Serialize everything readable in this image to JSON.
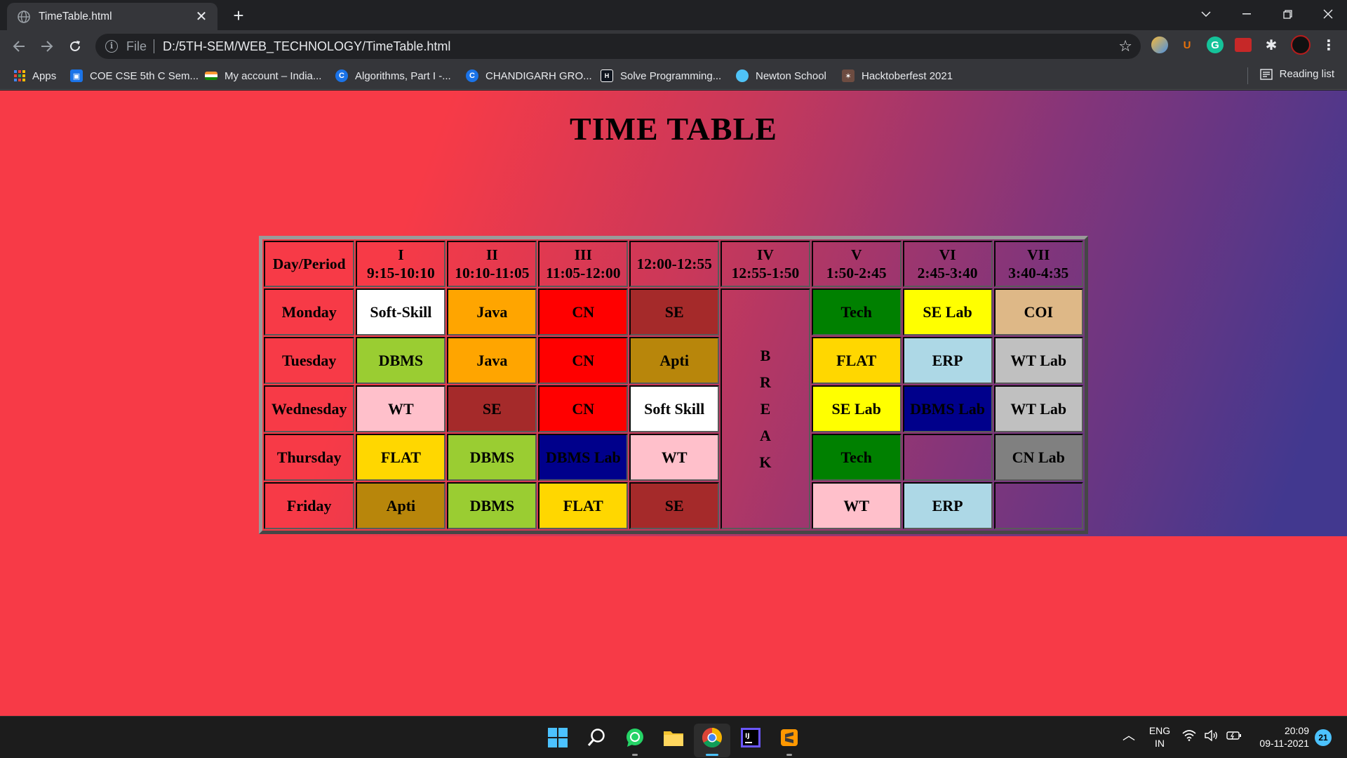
{
  "browser": {
    "tab_title": "TimeTable.html",
    "tab_close": "✕",
    "new_tab": "+",
    "file_chip": "File",
    "url": "D:/5TH-SEM/WEB_TECHNOLOGY/TimeTable.html",
    "extensions": [
      "chrome-ext-icon",
      "ublock-icon",
      "grammarly-icon",
      "ext-red-icon",
      "puzzle-icon",
      "profile-avatar"
    ]
  },
  "bookmarks": {
    "apps": "Apps",
    "items": [
      {
        "label": "COE CSE 5th C Sem...",
        "icon": "classroom-icon",
        "color": "#1a73e8"
      },
      {
        "label": "My account – India...",
        "icon": "india-flag-icon",
        "color": "#138808"
      },
      {
        "label": "Algorithms, Part I -...",
        "icon": "coursera-icon",
        "color": "#1a73e8"
      },
      {
        "label": "CHANDIGARH GRO...",
        "icon": "coursera-icon",
        "color": "#1a73e8"
      },
      {
        "label": "Solve Programming...",
        "icon": "hackerrank-icon",
        "color": "#0e141e"
      },
      {
        "label": "Newton School",
        "icon": "newton-icon",
        "color": "#4fc3f7"
      },
      {
        "label": "Hacktoberfest 2021",
        "icon": "hacktoberfest-icon",
        "color": "#ff8ae2"
      }
    ],
    "reading_list": "Reading list"
  },
  "page": {
    "title": "TIME TABLE",
    "table": {
      "header": [
        {
          "top": "",
          "bottom": "Day/Period"
        },
        {
          "top": "I",
          "bottom": "9:15-10:10"
        },
        {
          "top": "II",
          "bottom": "10:10-11:05"
        },
        {
          "top": "III",
          "bottom": "11:05-12:00"
        },
        {
          "top": "",
          "bottom": "12:00-12:55"
        },
        {
          "top": "IV",
          "bottom": "12:55-1:50"
        },
        {
          "top": "V",
          "bottom": "1:50-2:45"
        },
        {
          "top": "VI",
          "bottom": "2:45-3:40"
        },
        {
          "top": "VII",
          "bottom": "3:40-4:35"
        }
      ],
      "break_letters": [
        "B",
        "R",
        "E",
        "A",
        "K"
      ],
      "rows": [
        {
          "day": "Monday",
          "cells": [
            {
              "text": "Soft-Skill",
              "bg": "#ffffff"
            },
            {
              "text": "Java",
              "bg": "#ffa500"
            },
            {
              "text": "CN",
              "bg": "#ff0000"
            },
            {
              "text": "SE",
              "bg": "#a52a2a"
            },
            {
              "text": "Tech",
              "bg": "#008000"
            },
            {
              "text": "SE Lab",
              "bg": "#ffff00"
            },
            {
              "text": "COI",
              "bg": "#deb887"
            }
          ]
        },
        {
          "day": "Tuesday",
          "cells": [
            {
              "text": "DBMS",
              "bg": "#9acd32"
            },
            {
              "text": "Java",
              "bg": "#ffa500"
            },
            {
              "text": "CN",
              "bg": "#ff0000"
            },
            {
              "text": "Apti",
              "bg": "#b8860b"
            },
            {
              "text": "FLAT",
              "bg": "#ffd700"
            },
            {
              "text": "ERP",
              "bg": "#add8e6"
            },
            {
              "text": "WT Lab",
              "bg": "#c0c0c0"
            }
          ]
        },
        {
          "day": "Wednesday",
          "cells": [
            {
              "text": "WT",
              "bg": "#ffc0cb"
            },
            {
              "text": "SE",
              "bg": "#a52a2a"
            },
            {
              "text": "CN",
              "bg": "#ff0000"
            },
            {
              "text": "Soft Skill",
              "bg": "#ffffff"
            },
            {
              "text": "SE Lab",
              "bg": "#ffff00"
            },
            {
              "text": "DBMS Lab",
              "bg": "#00008b"
            },
            {
              "text": "WT Lab",
              "bg": "#c0c0c0"
            }
          ]
        },
        {
          "day": "Thursday",
          "cells": [
            {
              "text": "FLAT",
              "bg": "#ffd700"
            },
            {
              "text": "DBMS",
              "bg": "#9acd32"
            },
            {
              "text": "DBMS Lab",
              "bg": "#00008b"
            },
            {
              "text": "WT",
              "bg": "#ffc0cb"
            },
            {
              "text": "Tech",
              "bg": "#008000"
            },
            {
              "text": "",
              "bg": ""
            },
            {
              "text": "CN Lab",
              "bg": "#808080"
            }
          ]
        },
        {
          "day": "Friday",
          "cells": [
            {
              "text": "Apti",
              "bg": "#b8860b"
            },
            {
              "text": "DBMS",
              "bg": "#9acd32"
            },
            {
              "text": "FLAT",
              "bg": "#ffd700"
            },
            {
              "text": "SE",
              "bg": "#a52a2a"
            },
            {
              "text": "WT",
              "bg": "#ffc0cb"
            },
            {
              "text": "ERP",
              "bg": "#add8e6"
            },
            {
              "text": "",
              "bg": ""
            }
          ]
        }
      ]
    }
  },
  "taskbar": {
    "apps": [
      "windows-start-icon",
      "search-icon",
      "whatsapp-icon",
      "file-explorer-icon",
      "chrome-icon",
      "intellij-icon",
      "sublime-icon"
    ],
    "lang_top": "ENG",
    "lang_bottom": "IN",
    "time": "20:09",
    "date": "09-11-2021",
    "notifications": "21"
  }
}
